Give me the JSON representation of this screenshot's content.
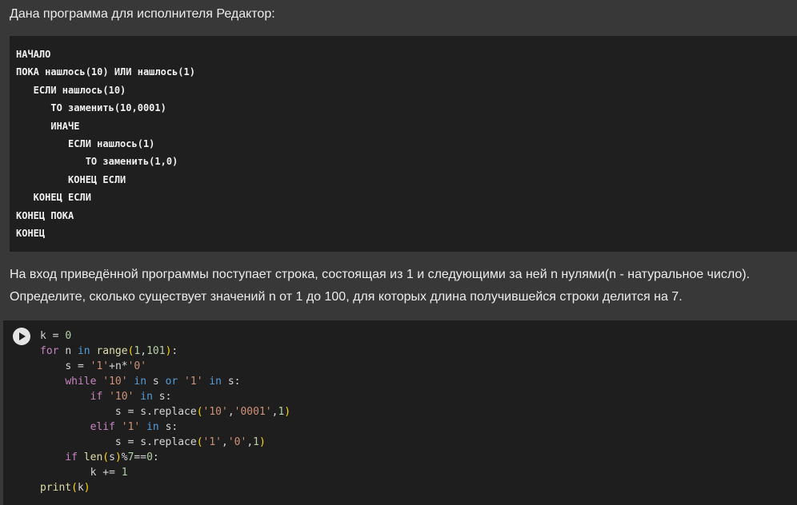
{
  "task": {
    "heading": "Дана программа для исполнителя Редактор:",
    "pseudocode": [
      "НАЧАЛО",
      "ПОКА нашлось(10) ИЛИ нашлось(1)",
      "   ЕСЛИ нашлось(10)",
      "      ТО заменить(10,0001)",
      "      ИНАЧЕ",
      "         ЕСЛИ нашлось(1)",
      "            ТО заменить(1,0)",
      "         КОНЕЦ ЕСЛИ",
      "   КОНЕЦ ЕСЛИ",
      "КОНЕЦ ПОКА",
      "КОНЕЦ"
    ],
    "description_line1": "На вход приведённой программы поступает строка, состоящая из 1 и следующими за ней n нулями(n - натуральное число).",
    "description_line2": "Определите, сколько существует значений n от 1 до 100, для которых длина получившейся строки делится на 7."
  },
  "code_cell": {
    "run_icon": "play-circle-icon",
    "lines": [
      "k = 0",
      "for n in range(1,101):",
      "    s = '1'+n*'0'",
      "    while '10' in s or '1' in s:",
      "        if '10' in s:",
      "            s = s.replace('10','0001',1)",
      "        elif '1' in s:",
      "            s = s.replace('1','0',1)",
      "    if len(s)%7==0:",
      "        k += 1",
      "print(k)"
    ]
  },
  "colors": {
    "page_background": "#383838",
    "block_background": "#1f1f1f",
    "keyword": "#569cd6",
    "string": "#ce9178",
    "number": "#b5cea8",
    "function": "#dcdcaa"
  }
}
